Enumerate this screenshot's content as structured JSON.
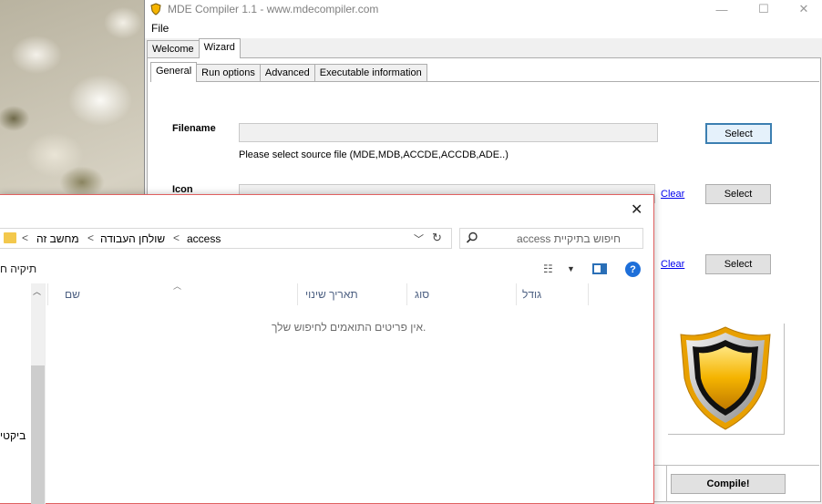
{
  "app": {
    "title": "MDE Compiler 1.1 - www.mdecompiler.com",
    "menu": [
      "File"
    ],
    "outer_tabs": [
      "Welcome",
      "Wizard"
    ],
    "outer_tab_active": "Wizard",
    "inner_tabs": [
      "General",
      "Run options",
      "Advanced",
      "Executable information"
    ],
    "inner_tab_active": "General",
    "filename_label": "Filename",
    "filename_value": "",
    "filename_hint": "Please select source file (MDE,MDB,ACCDE,ACCDB,ADE..)",
    "icon_label": "Icon",
    "select_label": "Select",
    "clear_label": "Clear",
    "compile_label": "Compile!"
  },
  "explorer": {
    "breadcrumb": [
      "מחשב זה",
      "שולחן העבודה",
      "access"
    ],
    "search_placeholder": "חיפוש בתיקיית  access",
    "new_folder_fragment": "תיקיה ח",
    "columns": [
      "שם",
      "תאריך שינוי",
      "סוג",
      "גודל"
    ],
    "empty_message": ".אין פריטים התואמים לחיפוש שלך",
    "nav_fragments": [
      "ביקטי"
    ]
  },
  "colors": {
    "accent": "#3c7fb1",
    "link": "#0000ee",
    "explorer_border": "#e06060",
    "shield_gold": "#f5b400"
  },
  "icons": [
    "app-shield-icon",
    "minimize-icon",
    "maximize-icon",
    "close-icon",
    "folder-icon",
    "chevron-icon",
    "dropdown-icon",
    "refresh-icon",
    "search-icon",
    "view-options-icon",
    "preview-pane-icon",
    "help-icon",
    "shield-icon"
  ]
}
